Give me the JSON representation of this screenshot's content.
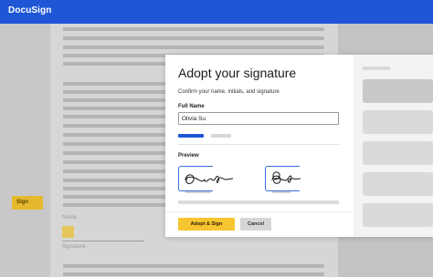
{
  "app": {
    "brand": "DocuSign"
  },
  "document": {
    "sign_tag_label": "Sign",
    "name_label": "Name",
    "signature_label": "Signature"
  },
  "modal": {
    "title": "Adopt your signature",
    "subtitle": "Confirm your name, initials, and signature",
    "full_name_label": "Full Name",
    "full_name_value": "Olivia Su",
    "preview_label": "Preview",
    "adopt_button": "Adopt & Sign",
    "cancel_button": "Cancel"
  },
  "colors": {
    "brand_blue": "#1e56d6",
    "accent_yellow": "#f6c531"
  }
}
